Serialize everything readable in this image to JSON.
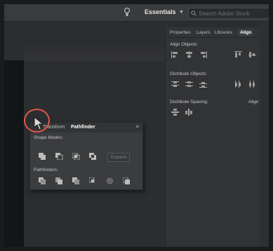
{
  "appbar": {
    "workspace_label": "Essentials",
    "search_placeholder": "Search Adobe Stock"
  },
  "right_panel": {
    "tabs": [
      {
        "label": "Properties"
      },
      {
        "label": "Layers"
      },
      {
        "label": "Libraries"
      },
      {
        "label": "Align"
      }
    ],
    "active_tab": "Align",
    "sections": {
      "align_objects": "Align Objects:",
      "distribute_objects": "Distribute Objects:",
      "distribute_spacing": "Distribute Spacing:",
      "align_to": "Align To:"
    }
  },
  "pathfinder_panel": {
    "tabs": [
      {
        "label": "Transform"
      },
      {
        "label": "Pathfinder"
      }
    ],
    "active_tab": "Pathfinder",
    "shape_modes_label": "Shape Modes:",
    "pathfinders_label": "Pathfinders:",
    "expand_label": "Expand"
  },
  "colors": {
    "highlight_circle": "#e0564a",
    "panel_bg": "#3b3c3e",
    "app_bg": "#2f3032"
  },
  "icons": [
    "lightbulb-icon",
    "search-icon",
    "chevron-down-icon",
    "panel-menu-icon",
    "cursor-arrow-icon"
  ]
}
